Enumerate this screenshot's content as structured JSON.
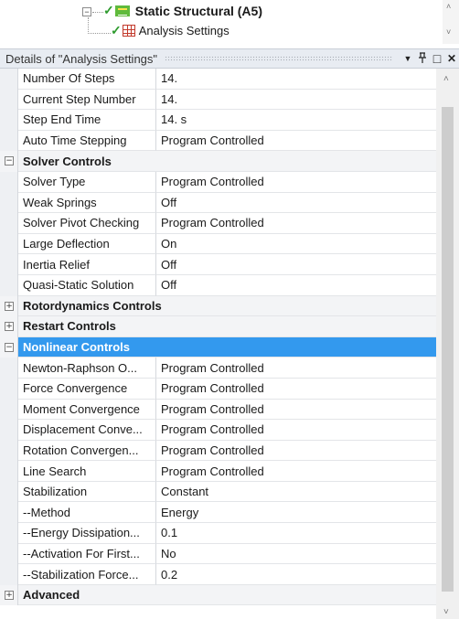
{
  "tree": {
    "static_structural": "Static Structural (A5)",
    "analysis_settings": "Analysis Settings"
  },
  "details": {
    "title": "Details of \"Analysis Settings\"",
    "pin_glyph": "Ŧ",
    "dropdown_glyph": "▼",
    "maximize_glyph": "□",
    "close_glyph": "✕"
  },
  "rows": [
    {
      "kind": "prop",
      "name": "Number Of Steps",
      "value": "14."
    },
    {
      "kind": "prop",
      "name": "Current Step Number",
      "value": "14."
    },
    {
      "kind": "prop",
      "name": "Step End Time",
      "value": "14. s"
    },
    {
      "kind": "prop",
      "name": "Auto Time Stepping",
      "value": "Program Controlled"
    },
    {
      "kind": "cat",
      "name": "Solver Controls",
      "expander": "−"
    },
    {
      "kind": "prop",
      "name": "Solver Type",
      "value": "Program Controlled"
    },
    {
      "kind": "prop",
      "name": "Weak Springs",
      "value": "Off"
    },
    {
      "kind": "prop",
      "name": "Solver Pivot Checking",
      "value": "Program Controlled"
    },
    {
      "kind": "prop",
      "name": "Large Deflection",
      "value": "On"
    },
    {
      "kind": "prop",
      "name": "Inertia Relief",
      "value": "Off"
    },
    {
      "kind": "prop",
      "name": "Quasi-Static Solution",
      "value": "Off"
    },
    {
      "kind": "cat",
      "name": "Rotordynamics Controls",
      "expander": "+"
    },
    {
      "kind": "cat",
      "name": "Restart Controls",
      "expander": "+"
    },
    {
      "kind": "cat",
      "name": "Nonlinear Controls",
      "expander": "−",
      "selected": true
    },
    {
      "kind": "prop",
      "name": "Newton-Raphson O...",
      "value": "Program Controlled"
    },
    {
      "kind": "prop",
      "name": "Force Convergence",
      "value": "Program Controlled"
    },
    {
      "kind": "prop",
      "name": "Moment Convergence",
      "value": "Program Controlled"
    },
    {
      "kind": "prop",
      "name": "Displacement Conve...",
      "value": "Program Controlled"
    },
    {
      "kind": "prop",
      "name": "Rotation Convergen...",
      "value": "Program Controlled"
    },
    {
      "kind": "prop",
      "name": "Line Search",
      "value": "Program Controlled"
    },
    {
      "kind": "prop",
      "name": "Stabilization",
      "value": "Constant"
    },
    {
      "kind": "prop",
      "name": "--Method",
      "value": "Energy"
    },
    {
      "kind": "prop",
      "name": "--Energy Dissipation...",
      "value": "0.1"
    },
    {
      "kind": "prop",
      "name": "--Activation For First...",
      "value": "No"
    },
    {
      "kind": "prop",
      "name": "--Stabilization Force...",
      "value": "0.2"
    },
    {
      "kind": "cat",
      "name": "Advanced",
      "expander": "+"
    }
  ],
  "colors": {
    "selected_row": "#3399ee",
    "check_green": "#2e9b2e"
  },
  "icons": {
    "scroll_up": "˄",
    "scroll_down": "˅"
  }
}
